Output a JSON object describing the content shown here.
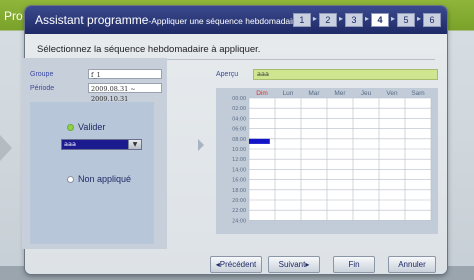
{
  "background_window": {
    "title": "Pro"
  },
  "dialog": {
    "title_main": "Assistant programme",
    "title_sub": "-Appliquer une séquence hebdomadaire",
    "steps": [
      "1",
      "2",
      "3",
      "4",
      "5",
      "6"
    ],
    "active_step": "4",
    "instruction": "Sélectionnez la séquence hebdomadaire à appliquer."
  },
  "form": {
    "groupe_label": "Groupe",
    "groupe_value": "f_1",
    "periode_label": "Période",
    "periode_value": "2009.08.31 ~ 2009.10.31",
    "valider_label": "Valider",
    "select_value": "aaa",
    "non_applique_label": "Non appliqué"
  },
  "preview": {
    "apercu_label": "Aperçu",
    "apercu_value": "aaa",
    "days": [
      "Dim",
      "Lun",
      "Mar",
      "Mer",
      "Jeu",
      "Ven",
      "Sam"
    ],
    "times": [
      "00:00",
      "02:00",
      "04:00",
      "06:00",
      "08:00",
      "10:00",
      "12:00",
      "14:00",
      "16:00",
      "18:00",
      "20:00",
      "22:00",
      "24:00"
    ],
    "highlight_day": "Dim",
    "highlight_color": "#d9302b",
    "event_bar": {
      "day": "Dim",
      "start": "08:00",
      "end": "09:00",
      "color": "#1313c8"
    }
  },
  "buttons": {
    "precedent": "◂Précédent",
    "suivant": "Suivant▸",
    "fin": "Fin",
    "annuler": "Annuler"
  }
}
